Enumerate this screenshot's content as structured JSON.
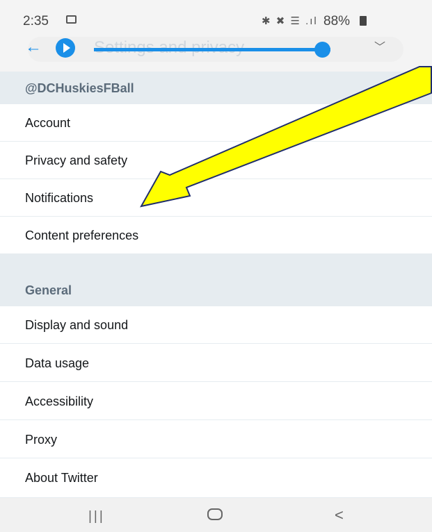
{
  "status_bar": {
    "time": "2:35",
    "icons": "✱ ✖ ☰ .ıl",
    "battery": "88%"
  },
  "header": {
    "title": "Settings and privacy",
    "back_icon": "arrow-left-icon",
    "play_icon": "play-icon",
    "collapse_icon": "chevron-down-icon"
  },
  "sections": {
    "account": {
      "title": "@DCHuskiesFBall",
      "items": [
        "Account",
        "Privacy and safety",
        "Notifications",
        "Content preferences"
      ]
    },
    "general": {
      "title": "General",
      "items": [
        "Display and sound",
        "Data usage",
        "Accessibility",
        "Proxy",
        "About Twitter"
      ]
    }
  },
  "colors": {
    "accent": "#1a8fe8",
    "section_bg": "#e6ecf0",
    "annotation": "#ffff00"
  }
}
